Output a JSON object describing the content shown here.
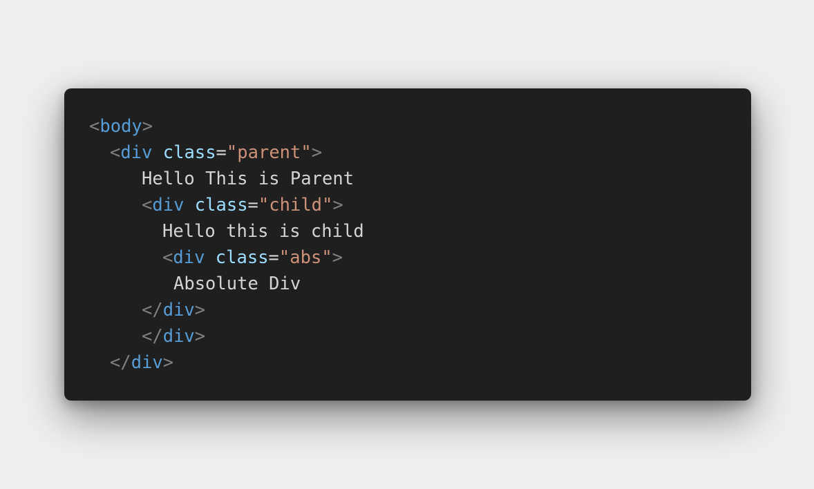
{
  "theme": {
    "background": "#efefef",
    "card_background": "#1f1f1f",
    "punctuation_color": "#808080",
    "tag_color": "#569cd6",
    "attribute_color": "#9cdcfe",
    "string_color": "#ce9178",
    "text_color": "#d4d4d4"
  },
  "code": {
    "line1": {
      "open": "<",
      "tag": "body",
      "close": ">"
    },
    "line2": {
      "open": "<",
      "tag": "div",
      "attr": "class",
      "eq": "=",
      "value": "\"parent\"",
      "close": ">"
    },
    "line3": {
      "text": "Hello This is Parent"
    },
    "line4": {
      "open": "<",
      "tag": "div",
      "attr": "class",
      "eq": "=",
      "value": "\"child\"",
      "close": ">"
    },
    "line5": {
      "text": "Hello this is child"
    },
    "line6": {
      "open": "<",
      "tag": "div",
      "attr": "class",
      "eq": "=",
      "value": "\"abs\"",
      "close": ">"
    },
    "line7": {
      "text": "Absolute Div"
    },
    "line8": {
      "open": "</",
      "tag": "div",
      "close": ">"
    },
    "line9": {
      "open": "</",
      "tag": "div",
      "close": ">"
    },
    "line10": {
      "open": "</",
      "tag": "div",
      "close": ">"
    }
  }
}
